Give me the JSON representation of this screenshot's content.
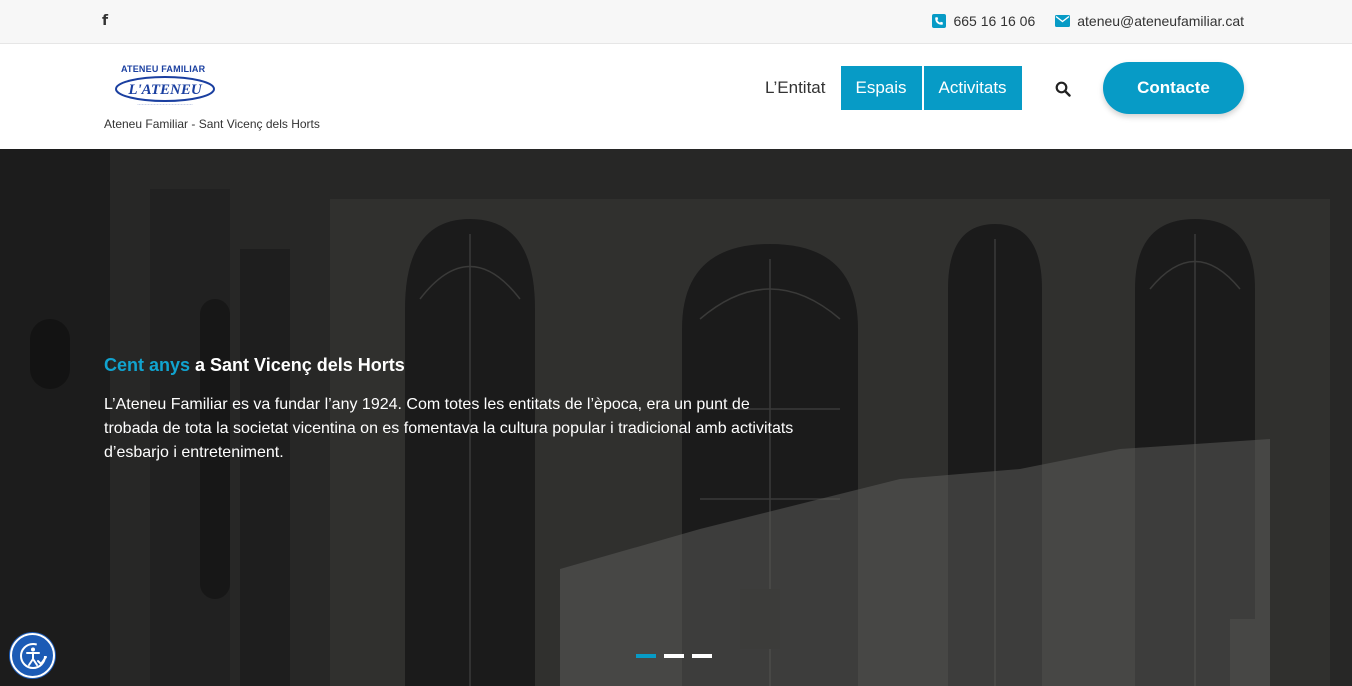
{
  "topbar": {
    "facebook_icon": "facebook-icon",
    "phone": "665 16 16 06",
    "email": "ateneu@ateneufamiliar.cat"
  },
  "header": {
    "logo_top": "ATENEU FAMILIAR",
    "logo_main": "L'ATENEU",
    "tagline": "Ateneu Familiar - Sant Vicenç dels Horts",
    "nav": [
      {
        "label": "L’Entitat",
        "active": false
      },
      {
        "label": "Espais",
        "active": true
      },
      {
        "label": "Activitats",
        "active": true
      }
    ],
    "contact_button": "Contacte"
  },
  "hero": {
    "title_accent": "Cent anys",
    "title_rest": " a Sant Vicenç dels Horts",
    "text": "L’Ateneu Familiar es va fundar l’any 1924. Com totes les entitats de l’època, era  un punt de trobada de tota la societat vicentina on es fomentava la cultura popular i tradicional amb activitats d’esbarjo i entreteniment.",
    "slides": 3,
    "active_slide": 1
  },
  "colors": {
    "accent": "#079bc6",
    "topbar_bg": "#f7f7f7",
    "a11y_button": "#1c5bb5"
  }
}
